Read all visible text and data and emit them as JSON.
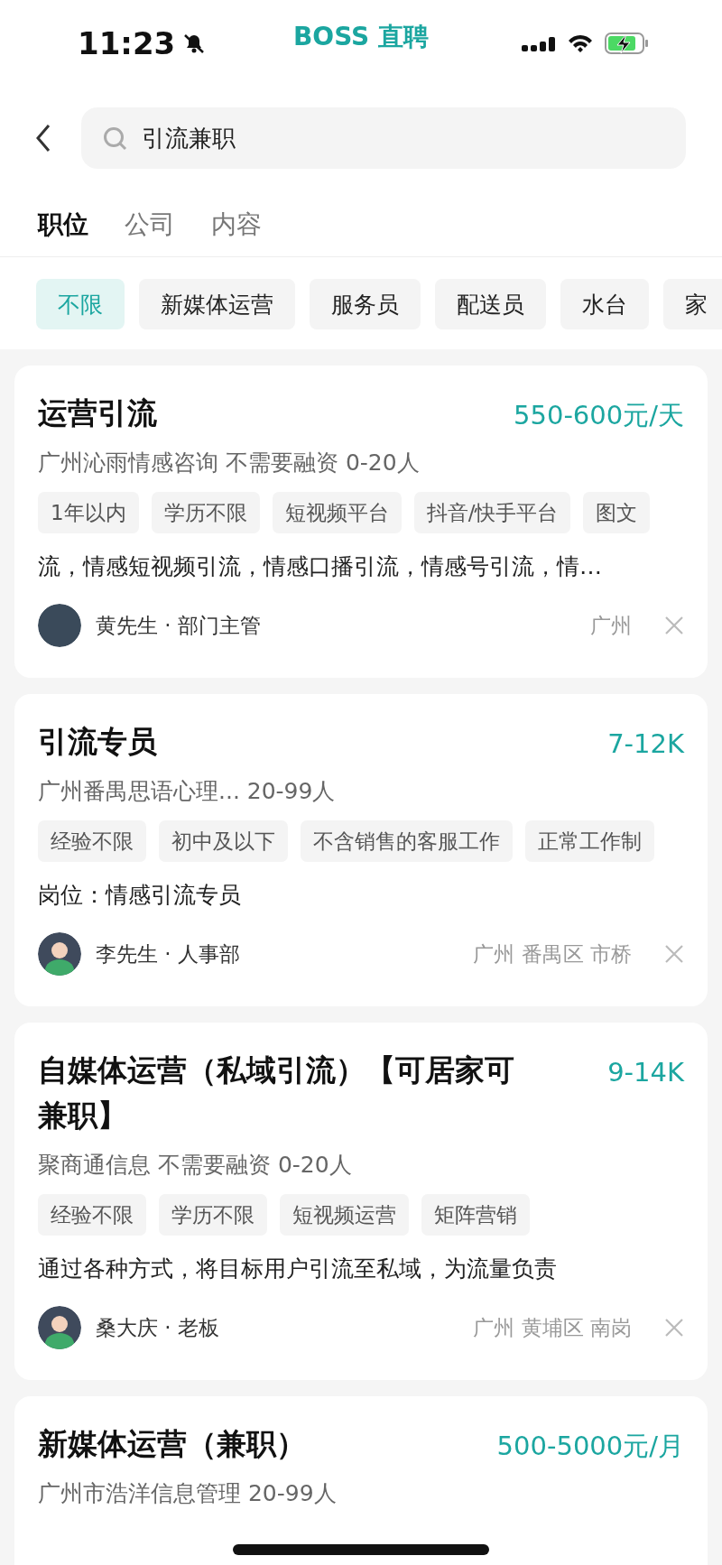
{
  "status_bar": {
    "time": "11:23",
    "app_label": "BOSS 直聘"
  },
  "search": {
    "value": "引流兼职"
  },
  "tabs": [
    {
      "label": "职位",
      "selected": true
    },
    {
      "label": "公司",
      "selected": false
    },
    {
      "label": "内容",
      "selected": false
    }
  ],
  "filters": [
    {
      "label": "不限",
      "selected": true
    },
    {
      "label": "新媒体运营",
      "selected": false
    },
    {
      "label": "服务员",
      "selected": false
    },
    {
      "label": "配送员",
      "selected": false
    },
    {
      "label": "水台",
      "selected": false
    },
    {
      "label": "家",
      "selected": false
    }
  ],
  "jobs": [
    {
      "title": "运营引流",
      "salary": "550-600元/天",
      "company": "广州沁雨情感咨询 不需要融资 0-20人",
      "tags": [
        "1年以内",
        "学历不限",
        "短视频平台",
        "抖音/快手平台",
        "图文"
      ],
      "description": "流，情感短视频引流，情感口播引流，情感号引流，情…",
      "recruiter": "黄先生 · 部门主管",
      "avatar": {
        "kind": "photo"
      },
      "location": "广州"
    },
    {
      "title": "引流专员",
      "salary": "7-12K",
      "company": "广州番禺思语心理... 20-99人",
      "tags": [
        "经验不限",
        "初中及以下",
        "不含销售的客服工作",
        "正常工作制"
      ],
      "description": "岗位：情感引流专员",
      "recruiter": "李先生 · 人事部",
      "avatar": {
        "kind": "cartoon"
      },
      "location": "广州 番禺区 市桥"
    },
    {
      "title": "自媒体运营（私域引流）【可居家可兼职】",
      "salary": "9-14K",
      "company": "聚商通信息 不需要融资 0-20人",
      "tags": [
        "经验不限",
        "学历不限",
        "短视频运营",
        "矩阵营销"
      ],
      "description": "通过各种方式，将目标用户引流至私域，为流量负责",
      "recruiter": "桑大庆 · 老板",
      "avatar": {
        "kind": "cartoon"
      },
      "location": "广州 黄埔区 南岗"
    },
    {
      "title": "新媒体运营（兼职）",
      "salary": "500-5000元/月",
      "company": "广州市浩洋信息管理 20-99人"
    }
  ]
}
